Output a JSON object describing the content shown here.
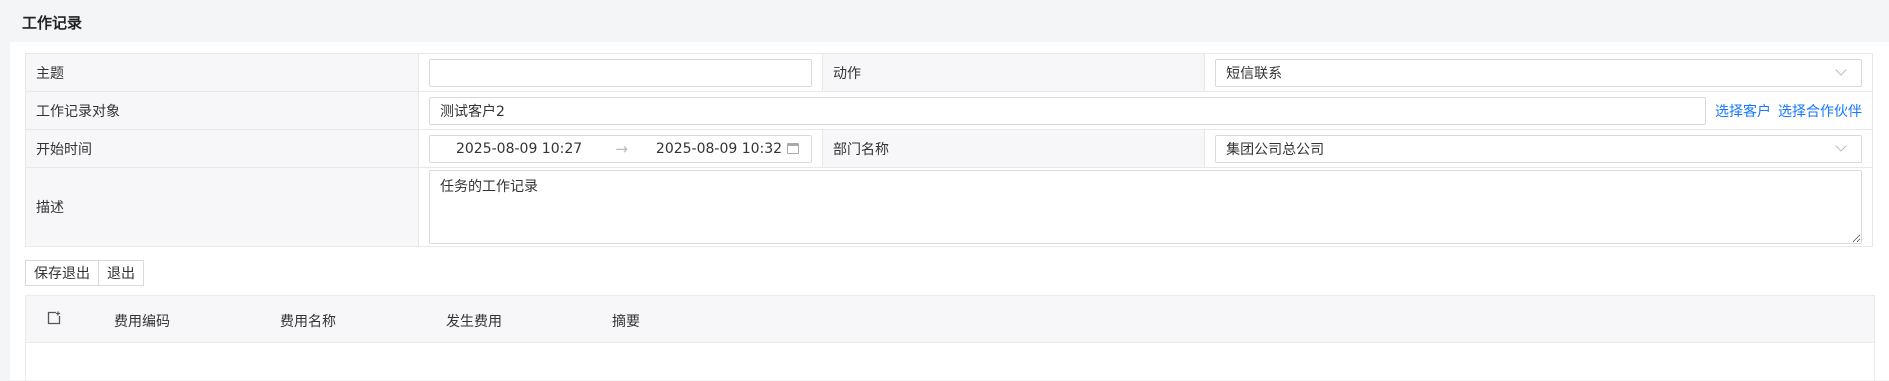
{
  "page": {
    "title": "工作记录"
  },
  "form": {
    "subject_label": "主题",
    "subject_value": "",
    "action_label": "动作",
    "action_value": "短信联系",
    "target_label": "工作记录对象",
    "target_value": "测试客户2",
    "select_customer": "选择客户",
    "select_partner": "选择合作伙伴",
    "start_label": "开始时间",
    "start_from": "2025-08-09 10:27",
    "start_to": "2025-08-09 10:32",
    "dept_label": "部门名称",
    "dept_value": "集团公司总公司",
    "desc_label": "描述",
    "desc_value": "任务的工作记录"
  },
  "buttons": {
    "save_exit": "保存退出",
    "exit": "退出"
  },
  "expense_table": {
    "columns": [
      "费用编码",
      "费用名称",
      "发生费用",
      "摘要"
    ]
  }
}
